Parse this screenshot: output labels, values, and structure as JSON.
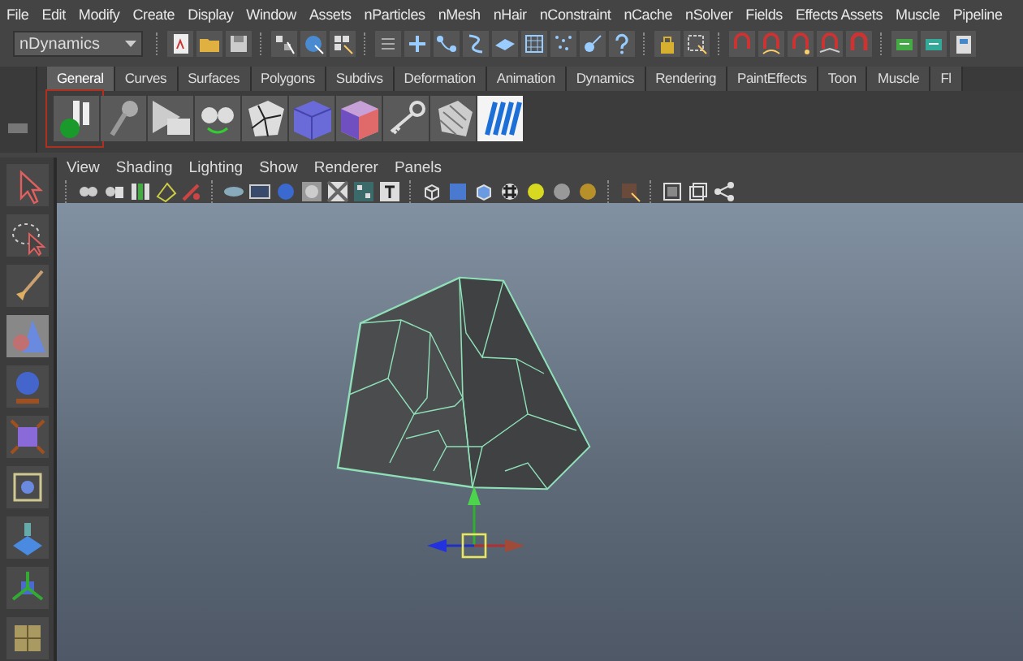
{
  "menu_bar": [
    "File",
    "Edit",
    "Modify",
    "Create",
    "Display",
    "Window",
    "Assets",
    "nParticles",
    "nMesh",
    "nHair",
    "nConstraint",
    "nCache",
    "nSolver",
    "Fields",
    "Effects Assets",
    "Muscle",
    "Pipeline"
  ],
  "mode_menu": {
    "value": "nDynamics"
  },
  "shelf_tabs": [
    {
      "label": "General",
      "selected": true
    },
    {
      "label": "Curves",
      "selected": false
    },
    {
      "label": "Surfaces",
      "selected": false
    },
    {
      "label": "Polygons",
      "selected": false
    },
    {
      "label": "Subdivs",
      "selected": false
    },
    {
      "label": "Deformation",
      "selected": false
    },
    {
      "label": "Animation",
      "selected": false
    },
    {
      "label": "Dynamics",
      "selected": false
    },
    {
      "label": "Rendering",
      "selected": false
    },
    {
      "label": "PaintEffects",
      "selected": false
    },
    {
      "label": "Toon",
      "selected": false
    },
    {
      "label": "Muscle",
      "selected": false
    },
    {
      "label": "Fl",
      "selected": false
    }
  ],
  "panel_menu": [
    "View",
    "Shading",
    "Lighting",
    "Show",
    "Renderer",
    "Panels"
  ]
}
